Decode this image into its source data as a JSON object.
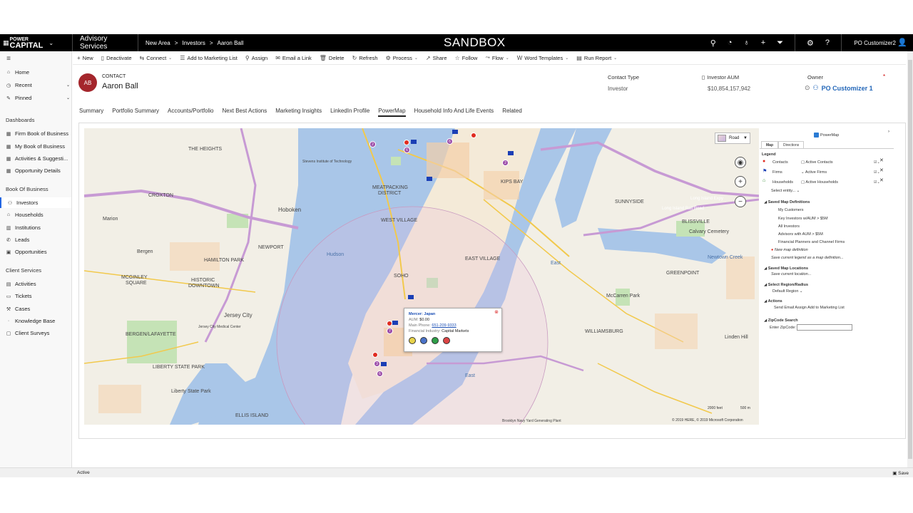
{
  "topbar": {
    "logo_top": "POWER",
    "logo_bottom": "CAPITAL",
    "app_name": "Advisory Services",
    "breadcrumbs": [
      "New Area",
      ">",
      "Investors",
      ">",
      "Aaron Ball"
    ],
    "environment": "SANDBOX",
    "user": "PO Customizer2"
  },
  "commands": [
    {
      "icon": "+",
      "label": "New",
      "name": "new-button"
    },
    {
      "icon": "▯",
      "label": "Deactivate",
      "name": "deactivate-button"
    },
    {
      "icon": "⇆",
      "label": "Connect",
      "name": "connect-button"
    },
    {
      "icon": "☰",
      "label": "Add to Marketing List",
      "name": "add-marketing-list-button"
    },
    {
      "icon": "⚲",
      "label": "Assign",
      "name": "assign-button"
    },
    {
      "icon": "✉",
      "label": "Email a Link",
      "name": "email-link-button"
    },
    {
      "icon": "🗑",
      "label": "Delete",
      "name": "delete-button"
    },
    {
      "icon": "↻",
      "label": "Refresh",
      "name": "refresh-button"
    },
    {
      "icon": "⚙",
      "label": "Process",
      "name": "process-button"
    },
    {
      "icon": "↗",
      "label": "Share",
      "name": "share-button"
    },
    {
      "icon": "☆",
      "label": "Follow",
      "name": "follow-button"
    },
    {
      "icon": "⤳",
      "label": "Flow",
      "name": "flow-button"
    },
    {
      "icon": "W",
      "label": "Word Templates",
      "name": "word-templates-button"
    },
    {
      "icon": "▤",
      "label": "Run Report",
      "name": "run-report-button"
    }
  ],
  "nav": {
    "home": "Home",
    "recent": "Recent",
    "pinned": "Pinned",
    "dashboards_title": "Dashboards",
    "dashboards": [
      "Firm Book of Business",
      "My Book of Business",
      "Activities & Suggesti...",
      "Opportunity Details"
    ],
    "book_title": "Book Of Business",
    "book": [
      "Investors",
      "Households",
      "Institutions",
      "Leads",
      "Opportunities"
    ],
    "client_title": "Client Services",
    "client": [
      "Activities",
      "Tickets",
      "Cases",
      "Knowledge Base",
      "Client Surveys"
    ]
  },
  "record": {
    "initials": "AB",
    "entity": "CONTACT",
    "name": "Aaron Ball",
    "contact_type_label": "Contact Type",
    "contact_type_value": "Investor",
    "aum_label": "Investor AUM",
    "aum_value": "$10,854,157,942",
    "owner_label": "Owner",
    "owner_value": "PO Customizer 1",
    "required_mark": "*"
  },
  "tabs": [
    "Summary",
    "Portfolio Summary",
    "Accounts/Portfolio",
    "Next Best Actions",
    "Marketing Insights",
    "LinkedIn Profile",
    "PowerMap",
    "Household Info And Life Events",
    "Related"
  ],
  "map": {
    "style_label": "Road",
    "labels": {
      "heights": "THE HEIGHTS",
      "hoboken": "Hoboken",
      "marion": "Marion",
      "bergen": "Bergen",
      "croxton": "CROXTON",
      "newport": "NEWPORT",
      "hamilton": "HAMILTON PARK",
      "historic1": "HISTORIC",
      "historic2": "DOWNTOWN",
      "mcginley1": "MCGINLEY",
      "mcginley2": "SQUARE",
      "jersey": "Jersey City",
      "bergen_lafayette": "BERGEN/LAFAYETTE",
      "liberty": "LIBERTY STATE PARK",
      "liberty_sp": "Liberty State Park",
      "ellis": "ELLIS ISLAND",
      "hudson": "Hudson",
      "meatpacking1": "MEATPACKING",
      "meatpacking2": "DISTRICT",
      "west_village": "WEST VILLAGE",
      "soho": "SOHO",
      "east_village": "EAST VILLAGE",
      "kips": "KIPS BAY",
      "east": "East",
      "sunnyside": "SUNNYSIDE",
      "blissville": "BLISSVILLE",
      "calvary": "Calvary Cemetery",
      "newtown": "Newtown Creek",
      "greenpoint": "GREENPOINT",
      "mccarren": "McCarren Park",
      "williamsburg": "WILLIAMSBURG",
      "linden": "Linden Hill",
      "stevens": "Stevens Institute of Technology",
      "jc_medical": "Jersey City Medical Center",
      "east2": "East",
      "navy_yard": "Brooklyn Navy Yard Generating Plant",
      "liie": "Long Island Expy",
      "lirr": "Long Island Rail Road"
    },
    "clusters": [
      "6",
      "2",
      "6",
      "2",
      "7",
      "3",
      "6"
    ],
    "scale_feet": "2000 feet",
    "scale_m": "500 m",
    "attribution": "© 2019 HERE, © 2019 Microsoft Corporation",
    "popup": {
      "title": "Mercer: Japan",
      "aum_label": "AUM:",
      "aum_value": "$0.00",
      "phone_label": "Main Phone:",
      "phone_value": "651-209-9333",
      "industry_label": "Financial Industry:",
      "industry_value": "Capital Markets"
    }
  },
  "panel": {
    "title": "PowerMap",
    "tab_map": "Map",
    "tab_directions": "Directions",
    "legend": "Legend",
    "contacts": "Contacts",
    "active_contacts": "Active Contacts",
    "firms": "Firms",
    "active_firms": "Active Firms",
    "households": "Households",
    "active_households": "Active Households",
    "select_entity": "Select entity...",
    "saved_defs": "Saved Map Definitions",
    "defs": [
      "My Customers",
      "Key Investors w/AUM > $5M",
      "All Investors",
      "Advisors with AUM > $5M",
      "Financial Planners and Channel Firms"
    ],
    "new_def": "New map definition",
    "save_legend": "Save current legend as a map definition...",
    "saved_locs": "Saved Map Locations",
    "save_loc": "Save current location...",
    "region": "Select Region/Radius",
    "default_region": "Default Region",
    "actions": "Actions",
    "action_items": "Send Email  Assign  Add to Marketing List",
    "zip_title": "ZipCode Search",
    "zip_label": "Enter ZipCode:"
  },
  "status": {
    "state": "Active",
    "save": "Save"
  }
}
